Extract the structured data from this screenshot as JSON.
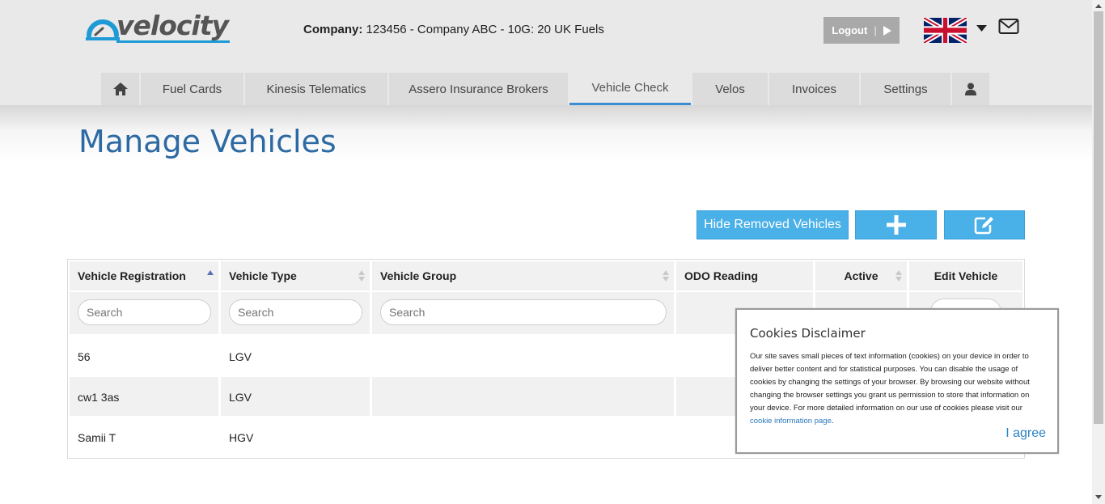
{
  "header": {
    "logo_text": "velocity",
    "company_label": "Company:",
    "company_value": "123456 - Company ABC - 10G: 20 UK Fuels",
    "logout_label": "Logout",
    "logout_sep": "|"
  },
  "nav": {
    "items": [
      {
        "label": ""
      },
      {
        "label": "Fuel Cards"
      },
      {
        "label": "Kinesis Telematics"
      },
      {
        "label": "Assero Insurance Brokers"
      },
      {
        "label": "Vehicle Check"
      },
      {
        "label": "Velos"
      },
      {
        "label": "Invoices"
      },
      {
        "label": "Settings"
      },
      {
        "label": ""
      }
    ],
    "active_index": 4
  },
  "page": {
    "title": "Manage Vehicles"
  },
  "actions": {
    "hide_removed_label": "Hide Removed Vehicles"
  },
  "table": {
    "columns": [
      {
        "label": "Vehicle Registration"
      },
      {
        "label": "Vehicle Type"
      },
      {
        "label": "Vehicle Group"
      },
      {
        "label": "ODO Reading"
      },
      {
        "label": "Active"
      },
      {
        "label": "Edit Vehicle"
      }
    ],
    "search_placeholder": "Search",
    "rows": [
      {
        "registration": "56",
        "type": "LGV"
      },
      {
        "registration": "cw1 3as",
        "type": "LGV"
      },
      {
        "registration": "Samii T",
        "type": "HGV"
      }
    ]
  },
  "cookie": {
    "title": "Cookies Disclaimer",
    "body": "Our site saves small pieces of text information (cookies) on your device in order to deliver better content and for statistical purposes. You can disable the usage of cookies by changing the settings of your browser. By browsing our website without changing the browser settings you grant us permission to store that information on your device. For more detailed information on our use of cookies please visit our ",
    "link_text": "cookie information page",
    "body_end": ".",
    "agree_label": "I agree"
  },
  "colors": {
    "accent_blue": "#4ab0e8",
    "title_blue": "#2d6aa3",
    "active_tab_underline": "#3a8dd0"
  },
  "icons": {
    "home": "home-icon",
    "user": "user-icon",
    "add": "plus-icon",
    "edit": "edit-icon",
    "mail": "mail-icon",
    "flag": "uk-flag-icon",
    "caret": "caret-down-icon",
    "play": "play-icon"
  }
}
